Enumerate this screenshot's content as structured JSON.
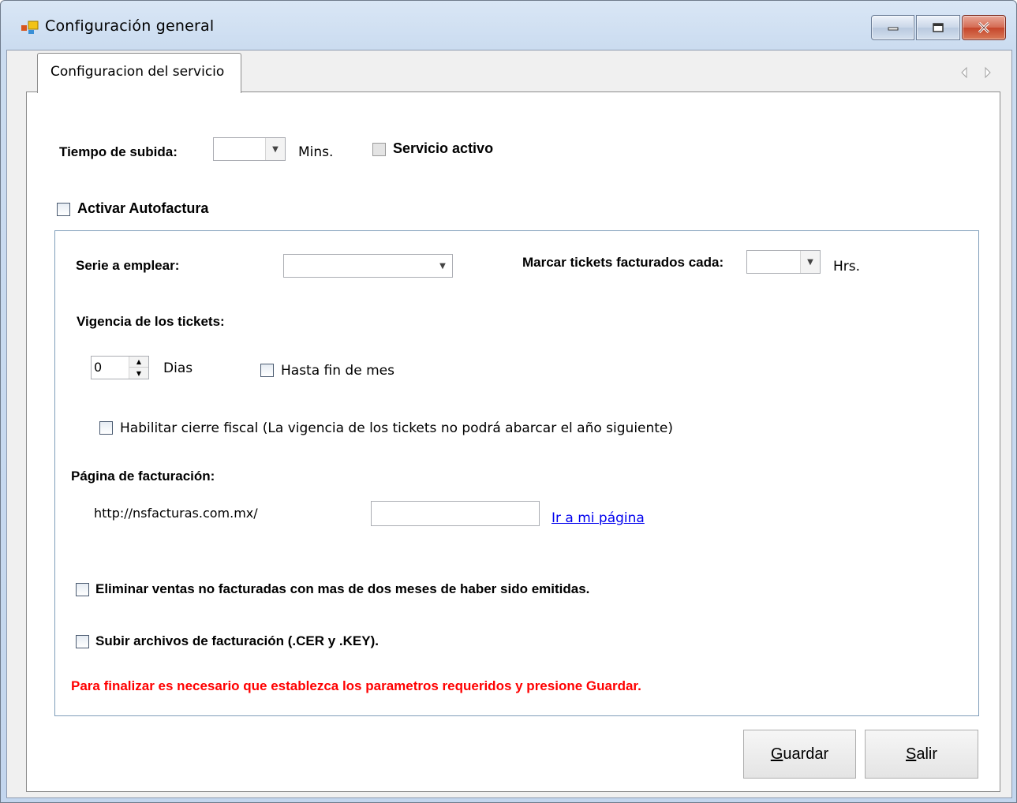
{
  "window": {
    "title": "Configuración general",
    "controls": [
      "minimize",
      "maximize",
      "close"
    ]
  },
  "tabs": [
    {
      "label": "Configuracion del servicio",
      "active": true
    }
  ],
  "service": {
    "upload_time_label": "Tiempo de subida:",
    "upload_time_value": "",
    "upload_time_unit": "Mins.",
    "active_label": "Servicio activo",
    "active_checked": false
  },
  "autofactura": {
    "enable_label": "Activar Autofactura",
    "enable_checked": false,
    "series_label": "Serie a emplear:",
    "series_value": "",
    "mark_label": "Marcar tickets facturados cada:",
    "mark_value": "",
    "mark_unit": "Hrs.",
    "validity_label": "Vigencia de los tickets:",
    "days_value": "0",
    "days_label": "Dias",
    "until_month_end_label": "Hasta fin de mes",
    "fiscal_close_label": "Habilitar cierre fiscal (La vigencia de los tickets no podrá abarcar el año siguiente)",
    "billing_page_label": "Página de facturación:",
    "billing_url_prefix": "http://nsfacturas.com.mx/",
    "billing_page_value": "",
    "go_link": "Ir a mi página",
    "delete_sales_label": "Eliminar ventas no facturadas con mas de dos meses de haber sido emitidas.",
    "upload_files_label": "Subir archivos de facturación (.CER y .KEY).",
    "notice": "Para finalizar es necesario que establezca los parametros requeridos y presione Guardar."
  },
  "buttons": {
    "save_u": "G",
    "save_rest": "uardar",
    "exit_u": "S",
    "exit_rest": "alir"
  },
  "colors": {
    "notice": "#ff0000",
    "link": "#0000ee",
    "close_button": "#c5452b"
  }
}
